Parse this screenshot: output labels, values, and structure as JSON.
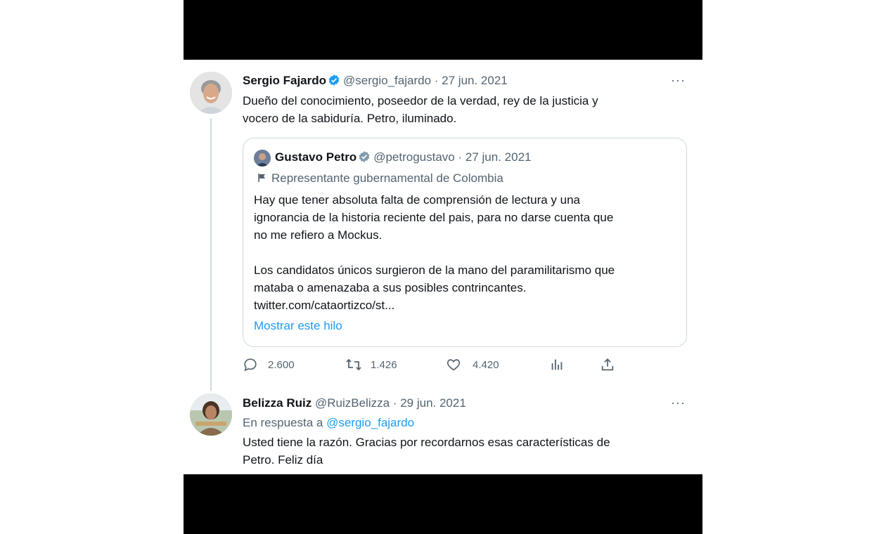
{
  "tweet": {
    "author_name": "Sergio Fajardo",
    "handle": "@sergio_fajardo",
    "separator": "·",
    "date": "27 jun. 2021",
    "more_label": "···",
    "text_line1": "Dueño del conocimiento, poseedor de la verdad, rey de la justicia y",
    "text_line2": "vocero de la sabiduría. Petro, iluminado."
  },
  "quote": {
    "author_name": "Gustavo Petro",
    "handle": "@petrogustavo",
    "separator": "·",
    "date": "27 jun. 2021",
    "label": "Representante gubernamental de Colombia",
    "lines": [
      "Hay que tener absoluta falta de comprensión de lectura y una",
      "ignorancia de la historia reciente del pais, para no darse cuenta que",
      "no me refiero a Mockus.",
      "Los candidatos únicos surgieron de la mano del paramilitarismo que",
      "mataba o amenazaba a sus posibles contrincantes.",
      "twitter.com/cataortizco/st..."
    ],
    "show_thread": "Mostrar este hilo"
  },
  "actions": {
    "replies": "2.600",
    "retweets": "1.426",
    "likes": "4.420"
  },
  "reply": {
    "author_name": "Belizza Ruiz",
    "handle": "@RuizBelizza",
    "separator": "·",
    "date": "29 jun. 2021",
    "more_label": "···",
    "reply_prefix": "En respuesta a",
    "reply_to": "@sergio_fajardo",
    "text_line1": "Usted tiene la razón. Gracias por recordarnos esas características de",
    "text_line2": "Petro. Feliz día"
  },
  "colors": {
    "accent": "#1d9bf0",
    "muted": "#536471",
    "border": "#cfd9de",
    "text": "#0f1419"
  }
}
